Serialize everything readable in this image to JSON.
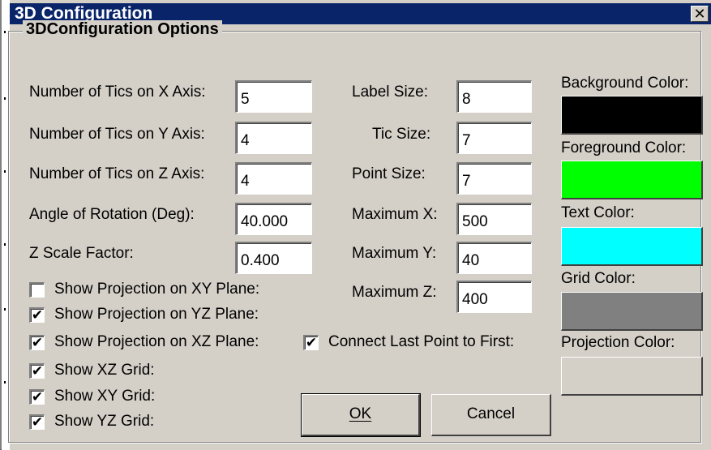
{
  "window": {
    "title": "3D Configuration",
    "close_glyph": "✕"
  },
  "group": {
    "title": "3DConfiguration Options"
  },
  "fields_left": [
    {
      "label": "Number of Tics on X Axis:",
      "value": "5"
    },
    {
      "label": "Number of Tics on Y Axis:",
      "value": "4"
    },
    {
      "label": "Number of Tics on Z Axis:",
      "value": "4"
    },
    {
      "label": "Angle of Rotation (Deg):",
      "value": "40.000"
    },
    {
      "label": "Z Scale Factor:",
      "value": "0.400"
    }
  ],
  "fields_mid": [
    {
      "label": "Label Size:",
      "value": "8"
    },
    {
      "label": "Tic Size:",
      "value": "7"
    },
    {
      "label": "Point Size:",
      "value": "7"
    },
    {
      "label": "Maximum X:",
      "value": "500"
    },
    {
      "label": "Maximum Y:",
      "value": "40"
    },
    {
      "label": "Maximum Z:",
      "value": "400"
    }
  ],
  "checkboxes": [
    {
      "label": "Show Projection on XY Plane:",
      "checked": false
    },
    {
      "label": "Show Projection on YZ Plane:",
      "checked": true
    },
    {
      "label": "Show Projection on XZ Plane:",
      "checked": true
    },
    {
      "label": "Show XZ Grid:",
      "checked": true
    },
    {
      "label": "Show XY Grid:",
      "checked": true
    },
    {
      "label": "Show YZ Grid:",
      "checked": true
    }
  ],
  "connect_checkbox": {
    "label": "Connect Last Point to First:",
    "checked": true
  },
  "check_glyph": "✔",
  "colors": [
    {
      "label": "Background Color:",
      "color": "#000000"
    },
    {
      "label": "Foreground Color:",
      "color": "#00ff00"
    },
    {
      "label": "Text Color:",
      "color": "#00ffff"
    },
    {
      "label": "Grid Color:",
      "color": "#808080"
    },
    {
      "label": "Projection Color:",
      "color": "#d4d0c8"
    }
  ],
  "buttons": {
    "ok": "OK",
    "cancel": "Cancel"
  }
}
